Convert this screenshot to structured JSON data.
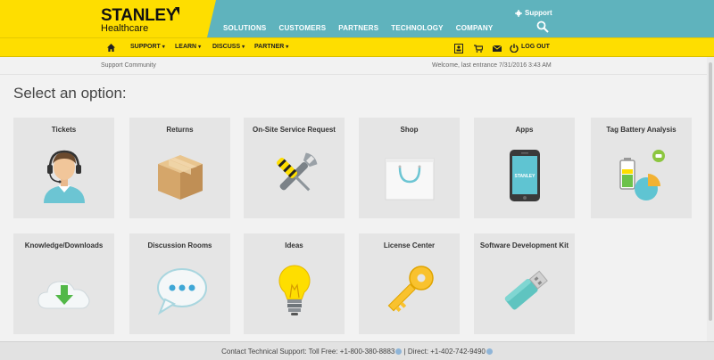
{
  "header": {
    "brand": "STANLEY",
    "brand_sub": "Healthcare",
    "nav": [
      "SOLUTIONS",
      "CUSTOMERS",
      "PARTNERS",
      "TECHNOLOGY",
      "COMPANY"
    ],
    "support_label": "Support",
    "support_icon": "gear-icon",
    "search_icon": "search-icon"
  },
  "subnav": {
    "home_icon": "home-icon",
    "items": [
      {
        "label": "SUPPORT"
      },
      {
        "label": "LEARN"
      },
      {
        "label": "DISCUSS"
      },
      {
        "label": "PARTNER"
      }
    ],
    "caret": "▾",
    "icons": [
      "profile-icon",
      "cart-icon",
      "mail-icon",
      "power-icon"
    ],
    "logout_label": "LOG OUT"
  },
  "infobar": {
    "left": "Support Community",
    "right": "Welcome, last entrance 7/31/2016 3:43 AM"
  },
  "main": {
    "heading": "Select an option:",
    "tiles": [
      {
        "label": "Tickets",
        "icon": "headset-agent-icon"
      },
      {
        "label": "Returns",
        "icon": "box-icon"
      },
      {
        "label": "On-Site Service Request",
        "icon": "wrench-screwdriver-icon"
      },
      {
        "label": "Shop",
        "icon": "shopping-bag-icon"
      },
      {
        "label": "Apps",
        "icon": "smartphone-icon",
        "phone_text": "STANLEY"
      },
      {
        "label": "Tag Battery Analysis",
        "icon": "battery-chart-icon"
      },
      {
        "label": "Knowledge/Downloads",
        "icon": "cloud-download-icon"
      },
      {
        "label": "Discussion Rooms",
        "icon": "chat-bubble-icon"
      },
      {
        "label": "Ideas",
        "icon": "lightbulb-icon"
      },
      {
        "label": "License Center",
        "icon": "key-icon"
      },
      {
        "label": "Software Development Kit",
        "icon": "usb-drive-icon"
      }
    ]
  },
  "footer": {
    "text": "Contact Technical Support: Toll Free: +1-800-380-8883",
    "separator": " | ",
    "direct": "Direct: +1-402-742-9490"
  },
  "colors": {
    "yellow": "#fede00",
    "teal": "#5fb3bd",
    "tile_bg": "#e5e5e5"
  }
}
